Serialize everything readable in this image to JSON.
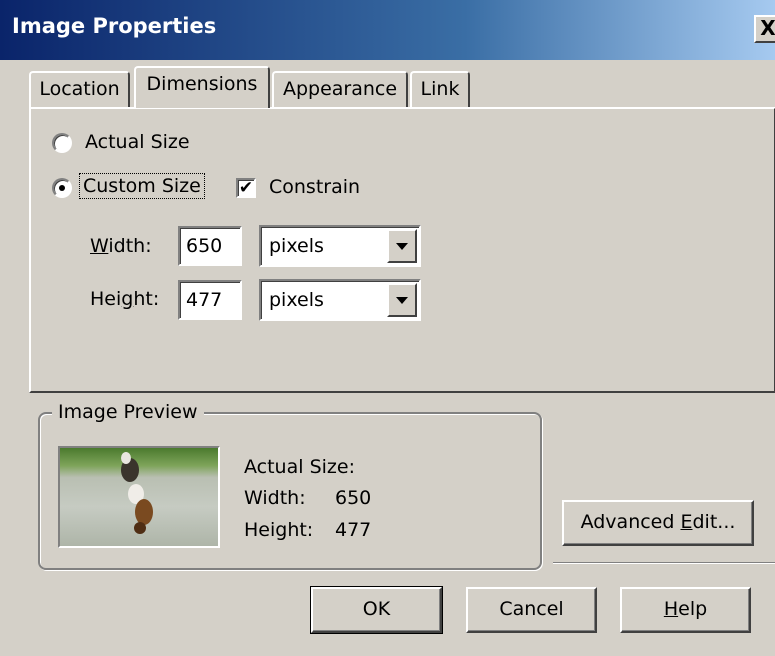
{
  "window": {
    "title": "Image Properties",
    "close_glyph": "X"
  },
  "tabs": [
    {
      "label": "Location"
    },
    {
      "label": "Dimensions"
    },
    {
      "label": "Appearance"
    },
    {
      "label": "Link"
    }
  ],
  "active_tab": "Dimensions",
  "dimensions": {
    "actual_size_label": "Actual Size",
    "custom_size_label": "Custom Size",
    "selected_option": "Custom Size",
    "constrain_label": "Constrain",
    "constrain_checked": true,
    "check_glyph": "✔",
    "width_label_pre": "",
    "width_label_u": "W",
    "width_label_post": "idth:",
    "width_value": "650",
    "width_unit": "pixels",
    "height_label_pre": "Hei",
    "height_label_u": "g",
    "height_label_post": "ht:",
    "height_value": "477",
    "height_unit": "pixels"
  },
  "preview": {
    "group_label": "Image Preview",
    "actual_size_label": "Actual Size:",
    "width_label": "Width:",
    "width_value": "650",
    "height_label": "Height:",
    "height_value": "477"
  },
  "buttons": {
    "advanced_edit_pre": "Advanced ",
    "advanced_edit_u": "E",
    "advanced_edit_post": "dit...",
    "ok": "OK",
    "cancel": "Cancel",
    "help_u": "H",
    "help_post": "elp"
  }
}
